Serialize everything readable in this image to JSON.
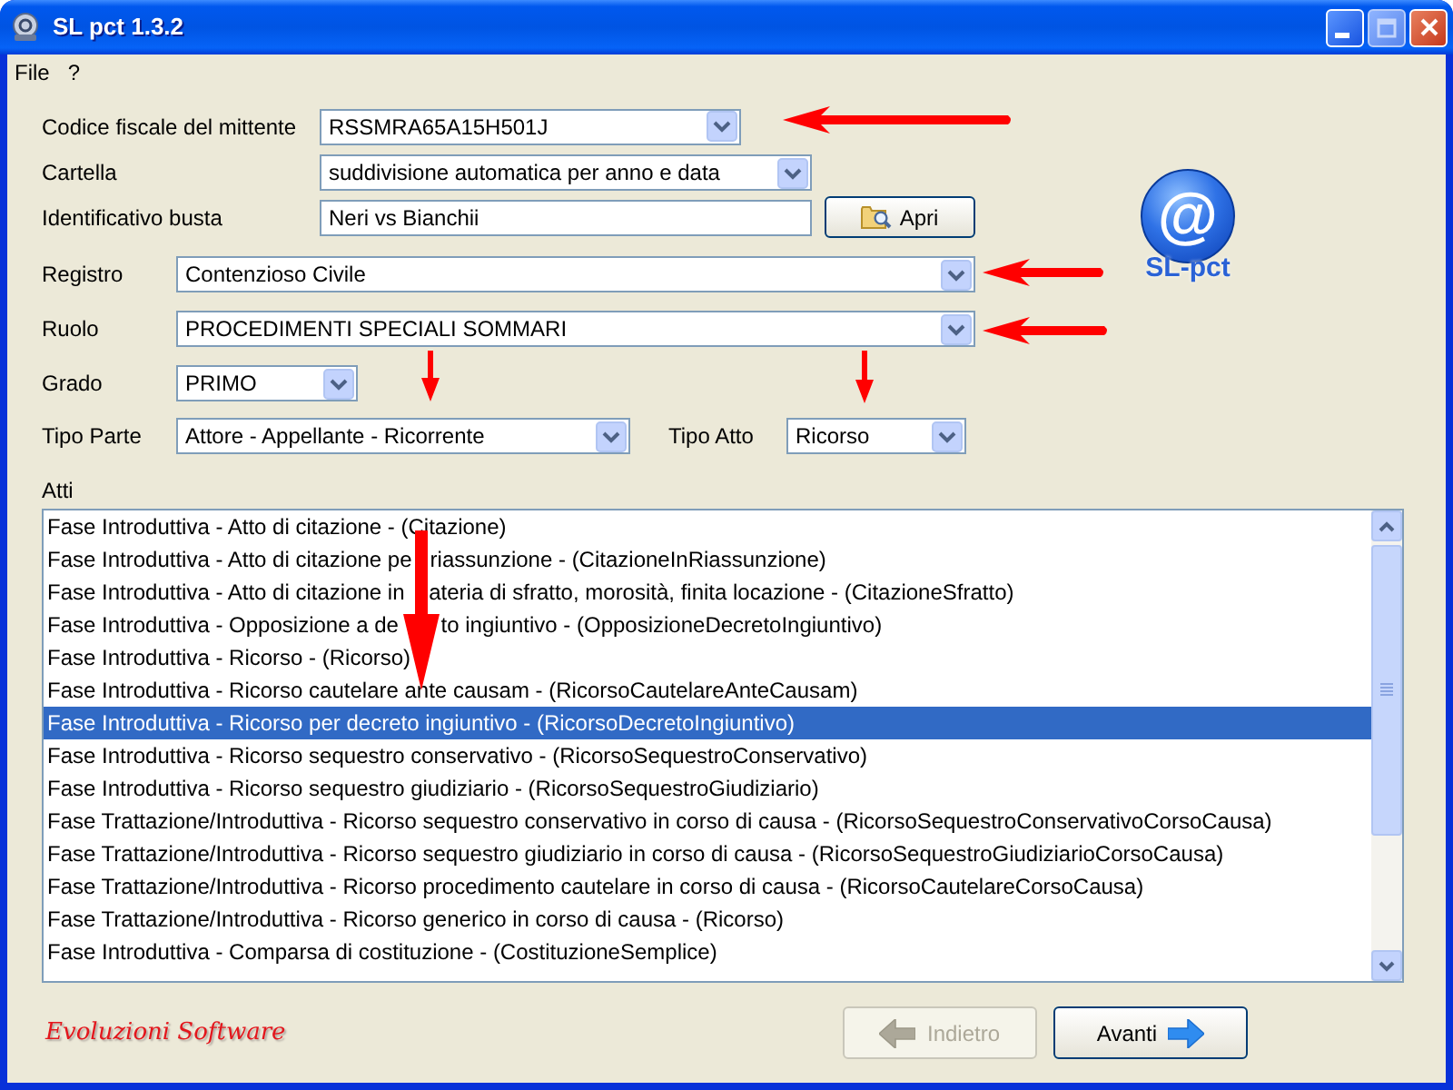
{
  "window": {
    "title": "SL pct 1.3.2",
    "maximize_enabled": false
  },
  "menu": [
    {
      "label": "File"
    },
    {
      "label": "?"
    }
  ],
  "sender": {
    "label": "Codice fiscale del mittente",
    "value": "RSSMRA65A15H501J"
  },
  "folder": {
    "label": "Cartella",
    "value": "suddivisione automatica per anno e data"
  },
  "envelope": {
    "label": "Identificativo busta",
    "value": "Neri vs Bianchii",
    "button": "Apri"
  },
  "logo": {
    "symbol": "@",
    "caption": "SL-pct"
  },
  "registry": {
    "label": "Registro",
    "value": "Contenzioso Civile"
  },
  "role": {
    "label": "Ruolo",
    "value": "PROCEDIMENTI SPECIALI SOMMARI"
  },
  "grade": {
    "label": "Grado",
    "value": "PRIMO"
  },
  "party_type": {
    "label": "Tipo Parte",
    "value": "Attore - Appellante - Ricorrente"
  },
  "act_type": {
    "label": "Tipo Atto",
    "value": "Ricorso"
  },
  "acts": {
    "label": "Atti",
    "items": [
      {
        "text": "Fase Introduttiva - Atto di citazione - (Citazione)",
        "selected": false
      },
      {
        "text": "Fase Introduttiva - Atto di citazione pe   riassunzione - (CitazioneInRiassunzione)",
        "selected": false
      },
      {
        "text": "Fase Introduttiva - Atto di citazione in    ateria di sfratto, morosità, finita locazione - (CitazioneSfratto)",
        "selected": false
      },
      {
        "text": "Fase Introduttiva - Opposizione a de       to ingiuntivo - (OpposizioneDecretoIngiuntivo)",
        "selected": false
      },
      {
        "text": "Fase Introduttiva - Ricorso - (Ricorso)",
        "selected": false
      },
      {
        "text": "Fase Introduttiva - Ricorso cautelare ante causam - (RicorsoCautelareAnteCausam)",
        "selected": false
      },
      {
        "text": "Fase Introduttiva - Ricorso per decreto ingiuntivo - (RicorsoDecretoIngiuntivo)",
        "selected": true
      },
      {
        "text": "Fase Introduttiva - Ricorso sequestro conservativo - (RicorsoSequestroConservativo)",
        "selected": false
      },
      {
        "text": "Fase Introduttiva - Ricorso sequestro giudiziario - (RicorsoSequestroGiudiziario)",
        "selected": false
      },
      {
        "text": "Fase Trattazione/Introduttiva - Ricorso sequestro conservativo in corso di causa - (RicorsoSequestroConservativoCorsoCausa)",
        "selected": false
      },
      {
        "text": "Fase Trattazione/Introduttiva - Ricorso sequestro giudiziario in corso di causa - (RicorsoSequestroGiudiziarioCorsoCausa)",
        "selected": false
      },
      {
        "text": "Fase Trattazione/Introduttiva - Ricorso procedimento cautelare in corso di causa - (RicorsoCautelareCorsoCausa)",
        "selected": false
      },
      {
        "text": "Fase Trattazione/Introduttiva - Ricorso generico in corso di causa - (Ricorso)",
        "selected": false
      },
      {
        "text": "Fase Introduttiva - Comparsa di costituzione - (CostituzioneSemplice)",
        "selected": false
      }
    ]
  },
  "footer": {
    "brand": "Evoluzioni Software",
    "buttons": [
      {
        "kind": "back",
        "label": "Indietro",
        "disabled": true
      },
      {
        "kind": "next",
        "label": "Avanti",
        "disabled": false
      }
    ]
  }
}
